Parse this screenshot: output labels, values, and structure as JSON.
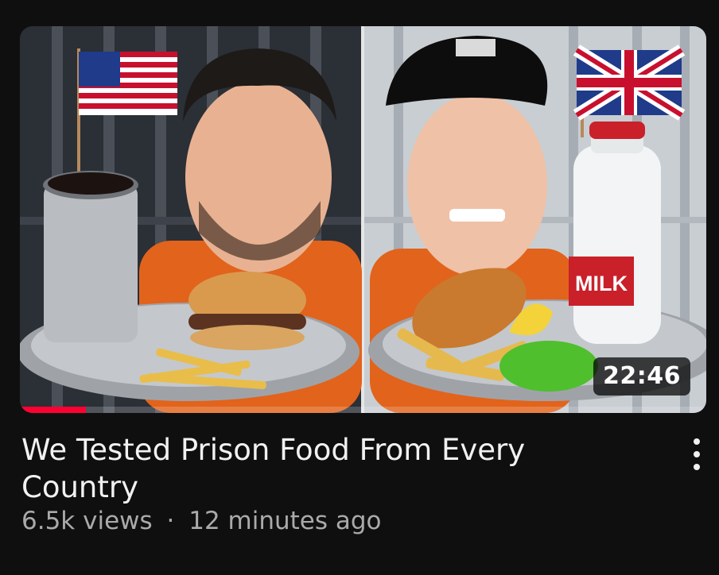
{
  "video": {
    "title": "We Tested Prison Food From Every Country",
    "views": "6.5k views",
    "separator": "·",
    "uploaded": "12 minutes ago",
    "duration": "22:46",
    "watch_progress": 0.096,
    "thumbnail_sign": "MILK",
    "menu_icon": "more-vertical-icon"
  },
  "colors": {
    "accent": "#ff0033",
    "background": "#0f0f0f",
    "title_text": "#f1f1f1",
    "meta_text": "#aaaaaa"
  }
}
